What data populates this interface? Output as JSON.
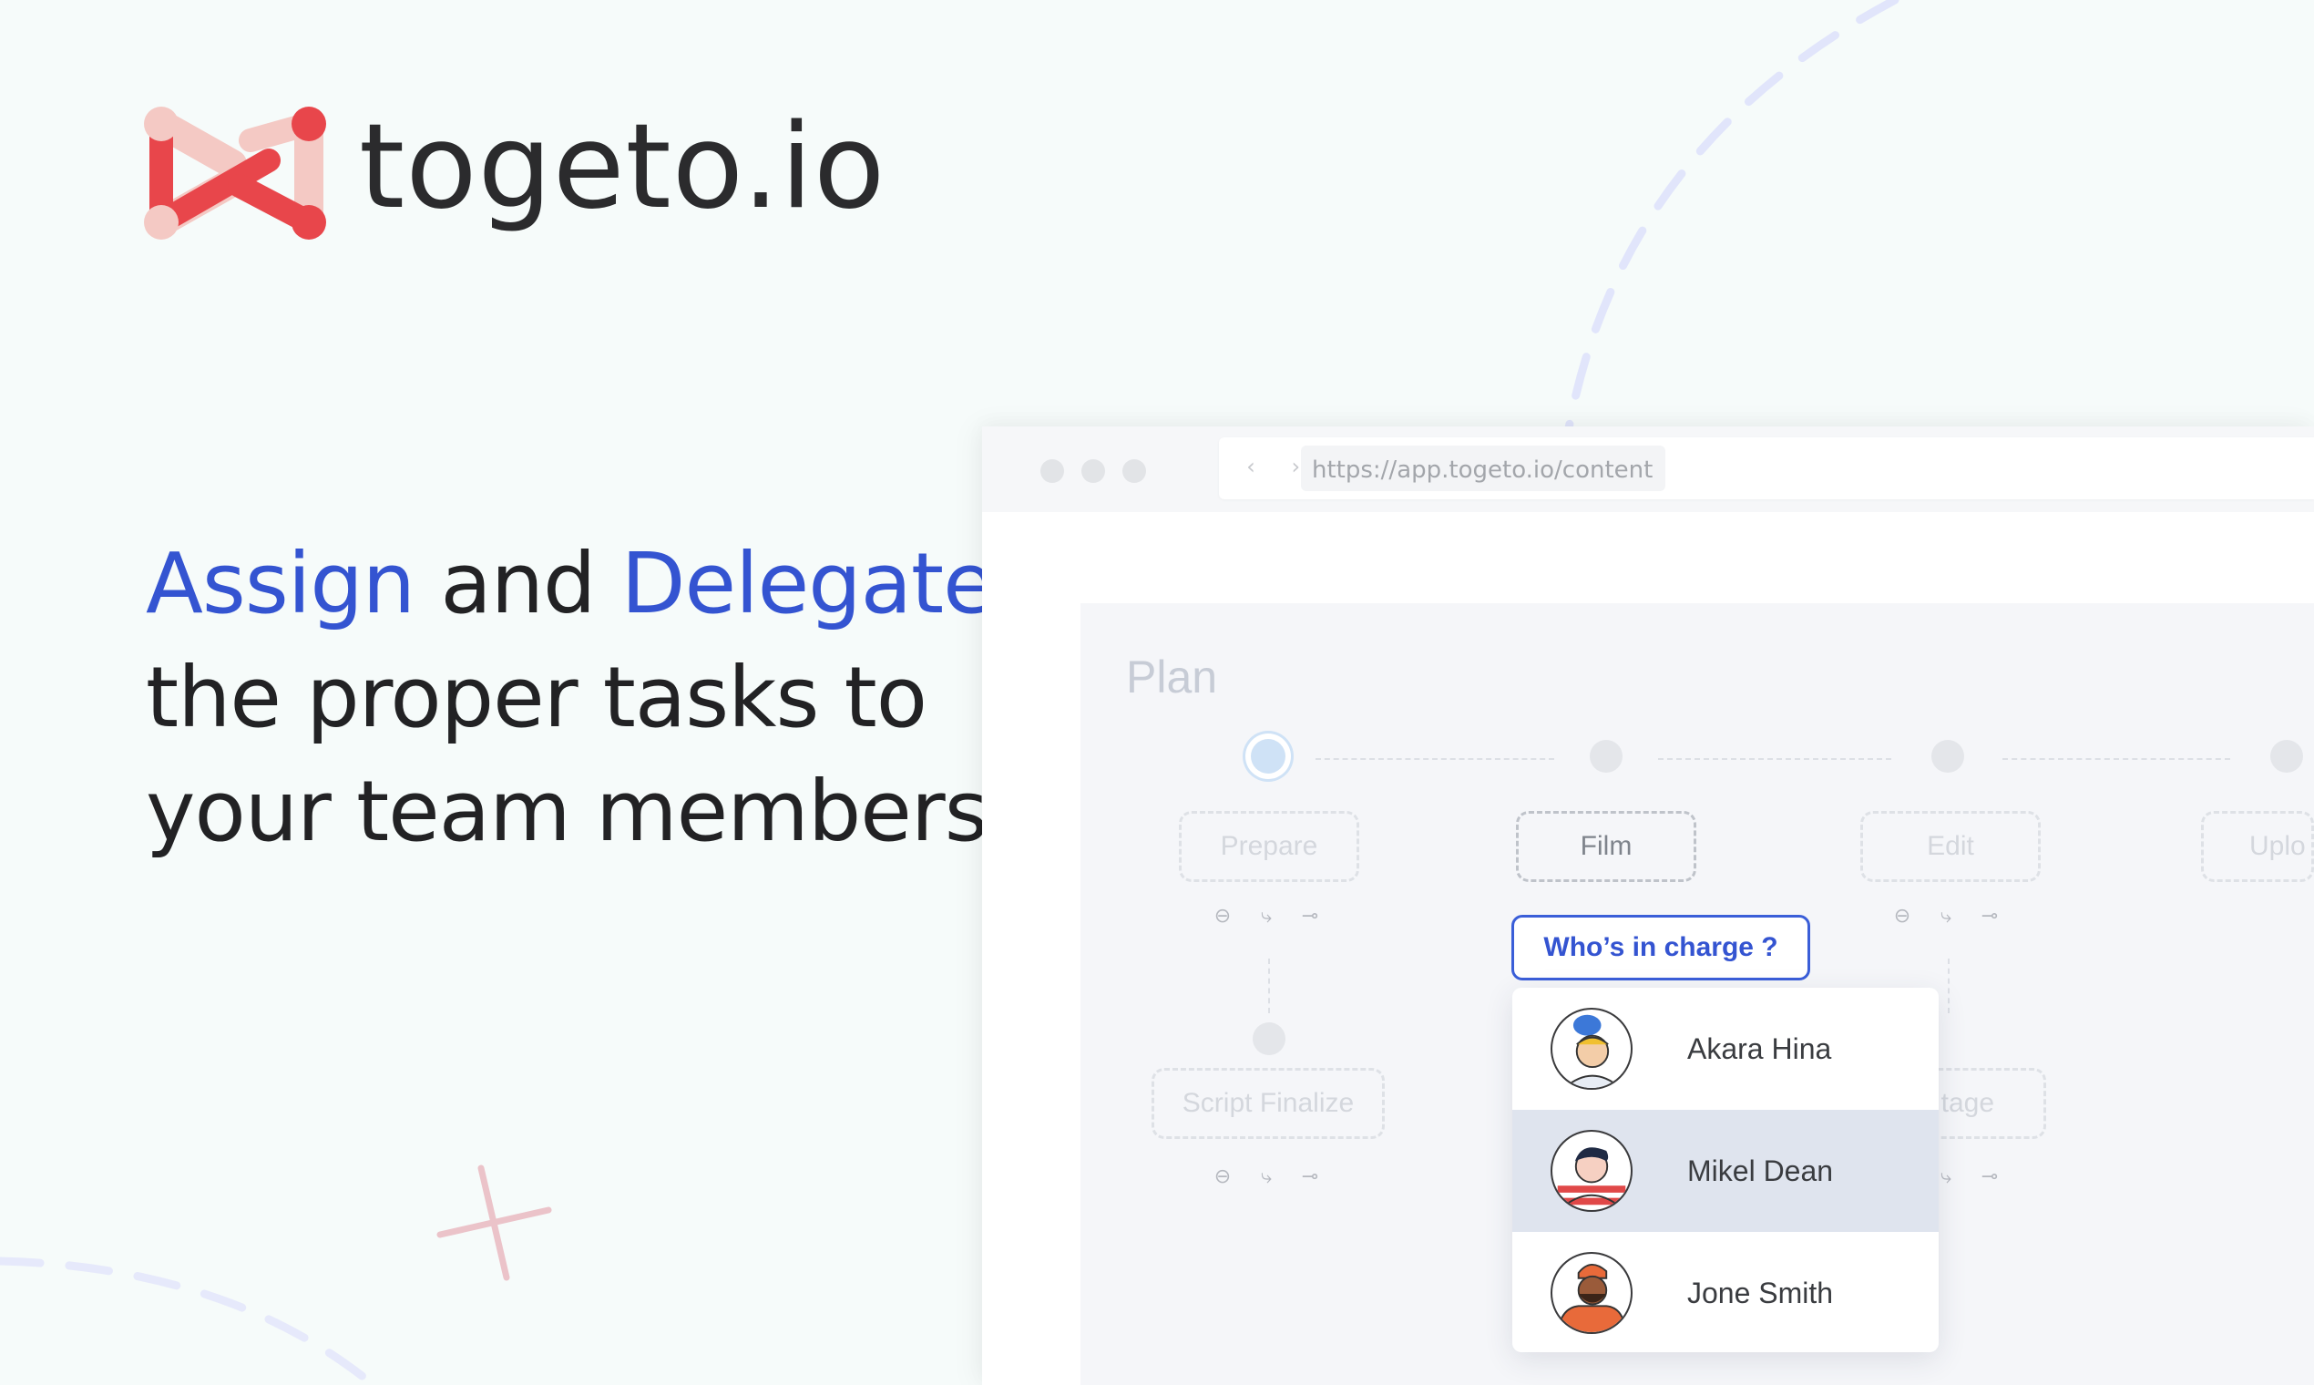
{
  "brand": {
    "name": "togeto.io",
    "colors": {
      "primary_red": "#e8464b",
      "light_pink": "#f4c9c4",
      "text": "#2b2b2d"
    }
  },
  "headline": {
    "highlight_1": "Assign",
    "connector": "and",
    "highlight_2": "Delegate",
    "line_2": "the proper tasks to",
    "line_3": "your team members",
    "accent_color": "#3454d1"
  },
  "browser": {
    "nav_arrows": "‹ ›",
    "url": "https://app.togeto.io/content"
  },
  "plan": {
    "title": "Plan",
    "stages": [
      {
        "label": "Prepare"
      },
      {
        "label": "Film"
      },
      {
        "label": "Edit"
      },
      {
        "label": "Uplo"
      }
    ],
    "substages": [
      {
        "label": "Script Finalize"
      },
      {
        "label": "tage"
      }
    ]
  },
  "assign": {
    "button_label": "Who’s in charge ?",
    "members": [
      {
        "name": "Akara Hina",
        "selected": false
      },
      {
        "name": "Mikel Dean",
        "selected": true
      },
      {
        "name": "Jone Smith",
        "selected": false
      }
    ]
  },
  "icons": [
    "logo-mark-icon",
    "remove-icon",
    "branch-icon",
    "link-icon",
    "avatar-icon"
  ]
}
